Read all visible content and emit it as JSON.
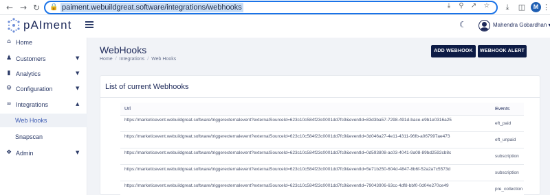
{
  "browser": {
    "url": "paiment.webuildgreat.software/integrations/webhooks",
    "profile_initial": "M"
  },
  "header": {
    "brand": "pAIment",
    "user_name": "Mahendra Gobardhan"
  },
  "sidebar": {
    "items": [
      {
        "label": "Home",
        "icon": "home-icon"
      },
      {
        "label": "Customers",
        "icon": "users-icon"
      },
      {
        "label": "Analytics",
        "icon": "chart-icon"
      },
      {
        "label": "Configuration",
        "icon": "gear-icon"
      },
      {
        "label": "Integrations",
        "icon": "link-icon"
      },
      {
        "label": "Web Hooks"
      },
      {
        "label": "Snapscan"
      },
      {
        "label": "Admin",
        "icon": "admin-icon"
      }
    ]
  },
  "page": {
    "title": "WebHooks",
    "breadcrumb": [
      "Home",
      "Integrations",
      "Web Hooks"
    ],
    "add_button": "ADD WEBHOOK",
    "alert_button": "WEBHOOK ALERT"
  },
  "card": {
    "title": "List of current Webhooks",
    "columns": [
      "Url",
      "Events"
    ],
    "rows": [
      {
        "url": "https://marketicevent.webuildgreat.software/triggerexternalevent?externalSourceId=623c10c584f23c0001dd7fc9&eventId=83d3ba57-7298-491d-bace-e9b1e0316a25",
        "event": "eft_paid"
      },
      {
        "url": "https://marketicevent.webuildgreat.software/triggerexternalevent?externalSourceId=623c10c584f23c0001dd7fc9&eventId=3d046a27-4e11-4311-96fb-a067997ae473",
        "event": "eft_unpaid"
      },
      {
        "url": "https://marketicevent.webuildgreat.software/triggerexternalevent?externalSourceId=623c10c584f23c0001dd7fc9&eventId=0d593808-ac03-4041-9a08-89bd2592cb8c",
        "event": "subscription"
      },
      {
        "url": "https://marketicevent.webuildgreat.software/triggerexternalevent?externalSourceId=623c10c584f23c0001dd7fc9&eventId=5e71b250-604d-4847-8b6f-52a2a7c5573d",
        "event": "subscription"
      },
      {
        "url": "https://marketicevent.webuildgreat.software/triggerexternalevent?externalSourceId=623c10c584f23c0001dd7fc9&eventId=79043906-63cc-4df8-bbf0-0d04e270ce49",
        "event": "pre_collection"
      }
    ]
  }
}
